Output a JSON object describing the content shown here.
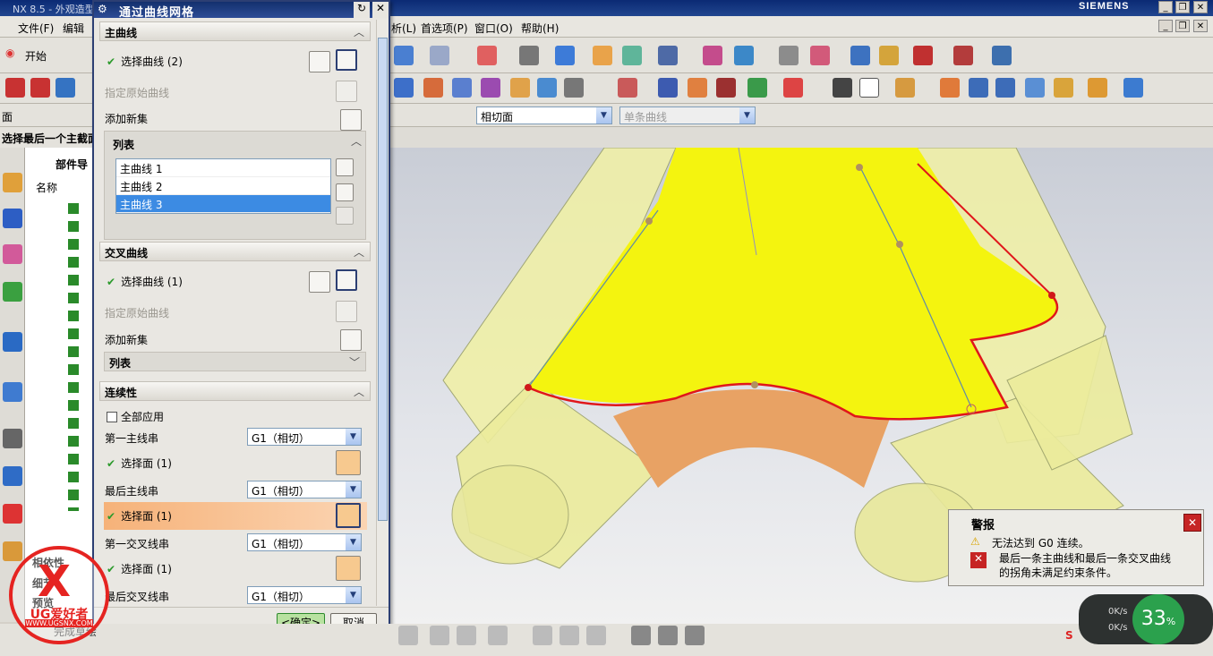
{
  "window": {
    "app_title": "NX 8.5 - 外观造型",
    "brand": "SIEMENS"
  },
  "menubar": {
    "file": "文件(F)",
    "edit": "编辑",
    "right_items": [
      "析(L)",
      "首选项(P)",
      "窗口(O)",
      "帮助(H)"
    ]
  },
  "toolbar": {
    "start": "开始",
    "filter_select": "相切面",
    "filter_select2": "单条曲线"
  },
  "left_panel": {
    "face_label": "面",
    "prompt": "选择最后一个主截面",
    "nav_title": "部件导",
    "name_col": "名称",
    "bottom_items": [
      "相依性",
      "细节",
      "预览"
    ]
  },
  "dialog": {
    "title": "通过曲线网格",
    "primary": {
      "header": "主曲线",
      "select": "选择曲线 (2)",
      "spec_origin": "指定原始曲线",
      "add_set": "添加新集",
      "list_header": "列表",
      "items": [
        "主曲线 1",
        "主曲线 2",
        "主曲线 3"
      ]
    },
    "cross": {
      "header": "交叉曲线",
      "select": "选择曲线 (1)",
      "spec_origin": "指定原始曲线",
      "add_set": "添加新集",
      "list_header": "列表"
    },
    "continuity": {
      "header": "连续性",
      "apply_all": "全部应用",
      "first_primary": "第一主线串",
      "first_primary_val": "G1（相切）",
      "face1": "选择面 (1)",
      "last_primary": "最后主线串",
      "last_primary_val": "G1（相切）",
      "face2": "选择面 (1)",
      "first_cross": "第一交叉线串",
      "first_cross_val": "G1（相切）",
      "face3": "选择面 (1)",
      "last_cross": "最后交叉线串",
      "last_cross_val": "G1（相切）"
    },
    "ok": "<确定>",
    "cancel": "取消"
  },
  "alert": {
    "title": "警报",
    "line1": "无法达到 G0 连续。",
    "line2": "最后一条主曲线和最后一条交叉曲线",
    "line3": "的拐角未满足约束条件。"
  },
  "meter": {
    "percent": "33",
    "unit": "%",
    "up": "0K/s",
    "down": "0K/s"
  },
  "watermark": {
    "text": "UG爱好者",
    "url": "WWW.UGSNX.COM"
  },
  "status": "完成草绘",
  "colors": {
    "yellow_surface": "#f4f40f",
    "edge_red": "#e0161a",
    "dialog_title": "#13306e"
  }
}
